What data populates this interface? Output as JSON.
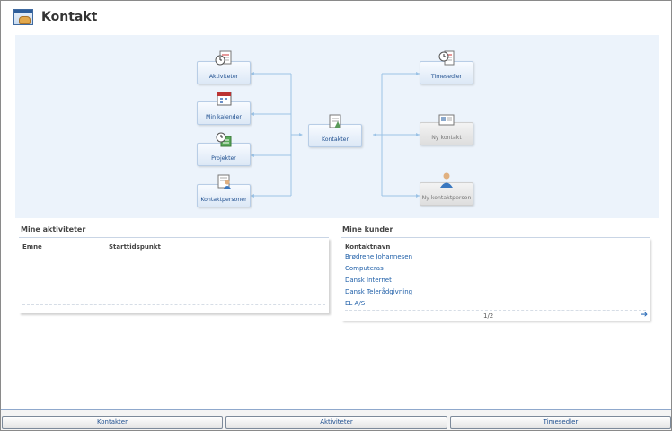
{
  "header": {
    "title": "Kontakt",
    "icon": "handshake-icon"
  },
  "diagram": {
    "nodes": {
      "aktiviteter": "Aktiviteter",
      "min_kalender": "Min kalender",
      "projekter": "Projekter",
      "kontaktpersoner": "Kontaktpersoner",
      "kontakter": "Kontakter",
      "timesedler": "Timesedler",
      "ny_kontakt": "Ny kontakt",
      "ny_kontaktperson": "Ny kontaktperson"
    }
  },
  "mine_aktiviteter": {
    "title": "Mine aktiviteter",
    "columns": [
      "Emne",
      "Starttidspunkt"
    ]
  },
  "mine_kunder": {
    "title": "Mine kunder",
    "column": "Kontaktnavn",
    "rows": [
      "Brødrene Johannesen",
      "Computeras",
      "Dansk Internet",
      "Dansk Telerådgivning",
      "EL A/S"
    ],
    "pager": "1/2"
  },
  "bottom_tabs": [
    "Kontakter",
    "Aktiviteter",
    "Timesedler"
  ],
  "colors": {
    "accent": "#1f5fa8",
    "panel_bg": "#ecf3fb",
    "connector": "#9cc3e6"
  }
}
